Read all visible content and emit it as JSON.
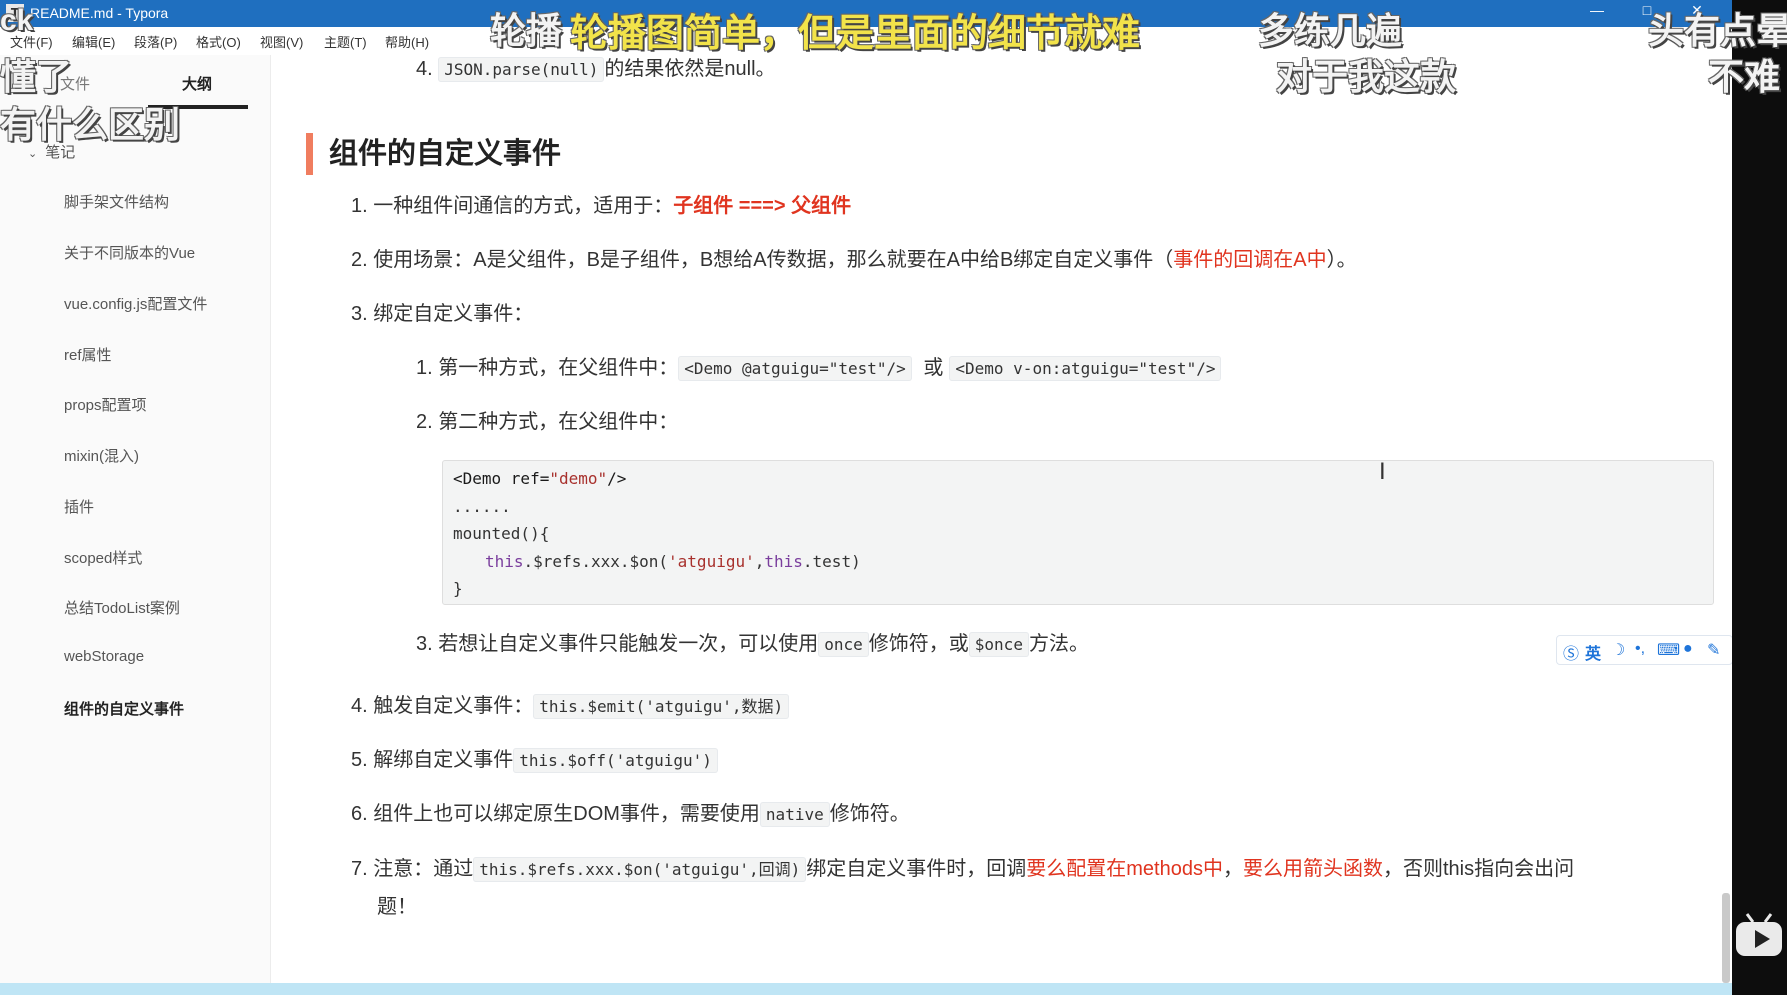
{
  "window": {
    "title": "README.md - Typora",
    "app_icon": "T",
    "controls": [
      "—",
      "□",
      "✕"
    ]
  },
  "menu": [
    "文件(F)",
    "编辑(E)",
    "段落(P)",
    "格式(O)",
    "视图(V)",
    "主题(T)",
    "帮助(H)"
  ],
  "sidebar": {
    "tabs": [
      "文件",
      "大纲"
    ],
    "active_tab": "大纲",
    "root": "笔记",
    "items": [
      "脚手架文件结构",
      "关于不同版本的Vue",
      "vue.config.js配置文件",
      "ref属性",
      "props配置项",
      "mixin(混入)",
      "插件",
      "scoped样式",
      "总结TodoList案例",
      "webStorage",
      "组件的自定义事件"
    ],
    "active_item": "组件的自定义事件"
  },
  "content": {
    "prev_item": {
      "num": "4.",
      "code": "JSON.parse(null)",
      "text": "的结果依然是null。"
    },
    "heading": "组件的自定义事件",
    "items": {
      "i1": {
        "num": "1.",
        "text": "一种组件间通信的方式，适用于：",
        "highlight": "子组件 ===> 父组件"
      },
      "i2": {
        "num": "2.",
        "text": "使用场景：A是父组件，B是子组件，B想给A传数据，那么就要在A中给B绑定自定义事件（",
        "highlight": "事件的回调在A中",
        "end": "）。"
      },
      "i3": {
        "num": "3.",
        "text": "绑定自定义事件："
      },
      "i3_1": {
        "num": "1.",
        "text": "第一种方式，在父组件中：",
        "code1": "<Demo @atguigu=\"test\"/>",
        "mid": "或",
        "code2": "<Demo v-on:atguigu=\"test\"/>"
      },
      "i3_2": {
        "num": "2.",
        "text": "第二种方式，在父组件中："
      },
      "i3_3": {
        "num": "3.",
        "text": "若想让自定义事件只能触发一次，可以使用",
        "code1": "once",
        "mid": "修饰符，或",
        "code2": "$once",
        "end": "方法。"
      },
      "i4": {
        "num": "4.",
        "text": "触发自定义事件：",
        "code": "this.$emit('atguigu',数据)"
      },
      "i5": {
        "num": "5.",
        "text": "解绑自定义事件",
        "code": "this.$off('atguigu')"
      },
      "i6": {
        "num": "6.",
        "text": "组件上也可以绑定原生DOM事件，需要使用",
        "code": "native",
        "end": "修饰符。"
      },
      "i7": {
        "num": "7.",
        "text": "注意：通过",
        "code": "this.$refs.xxx.$on('atguigu',回调)",
        "mid": "绑定自定义事件时，回调",
        "hl1": "要么配置在methods中",
        "sep": "，",
        "hl2": "要么用箭头函数",
        "end": "，否则this指向会出问",
        "end2": "题！"
      }
    },
    "code_block": {
      "l1a": "<Demo ref=",
      "l1b": "\"demo\"",
      "l1c": "/>",
      "l2": "......",
      "l3": "mounted(){",
      "l4a": "this",
      "l4b": ".$refs.xxx.$on(",
      "l4c": "'atguigu'",
      "l4d": ",",
      "l4e": "this",
      "l4f": ".test)",
      "l5": "}"
    }
  },
  "ime_toolbar": {
    "lang": "英",
    "icons": [
      "sogou-icon",
      "moon-icon",
      "punctuation-icon",
      "keyboard-icon",
      "user-icon",
      "wrench-icon"
    ]
  },
  "overlay": {
    "danmaku": {
      "d1": "轮播",
      "d2": "轮播图简单，但是里面的细节就难",
      "d3": "多练几遍",
      "d4": "对于我这款",
      "d5": "头有点晕",
      "d6": "不难",
      "d7": "ck",
      "d8": "懂了",
      "d9": "有什么区别"
    }
  },
  "colors": {
    "titlebar": "#1f6fbf",
    "heading_bar": "#f07d5f",
    "highlight": "#e0341f",
    "danmaku_yellow": "#f2e34a"
  }
}
